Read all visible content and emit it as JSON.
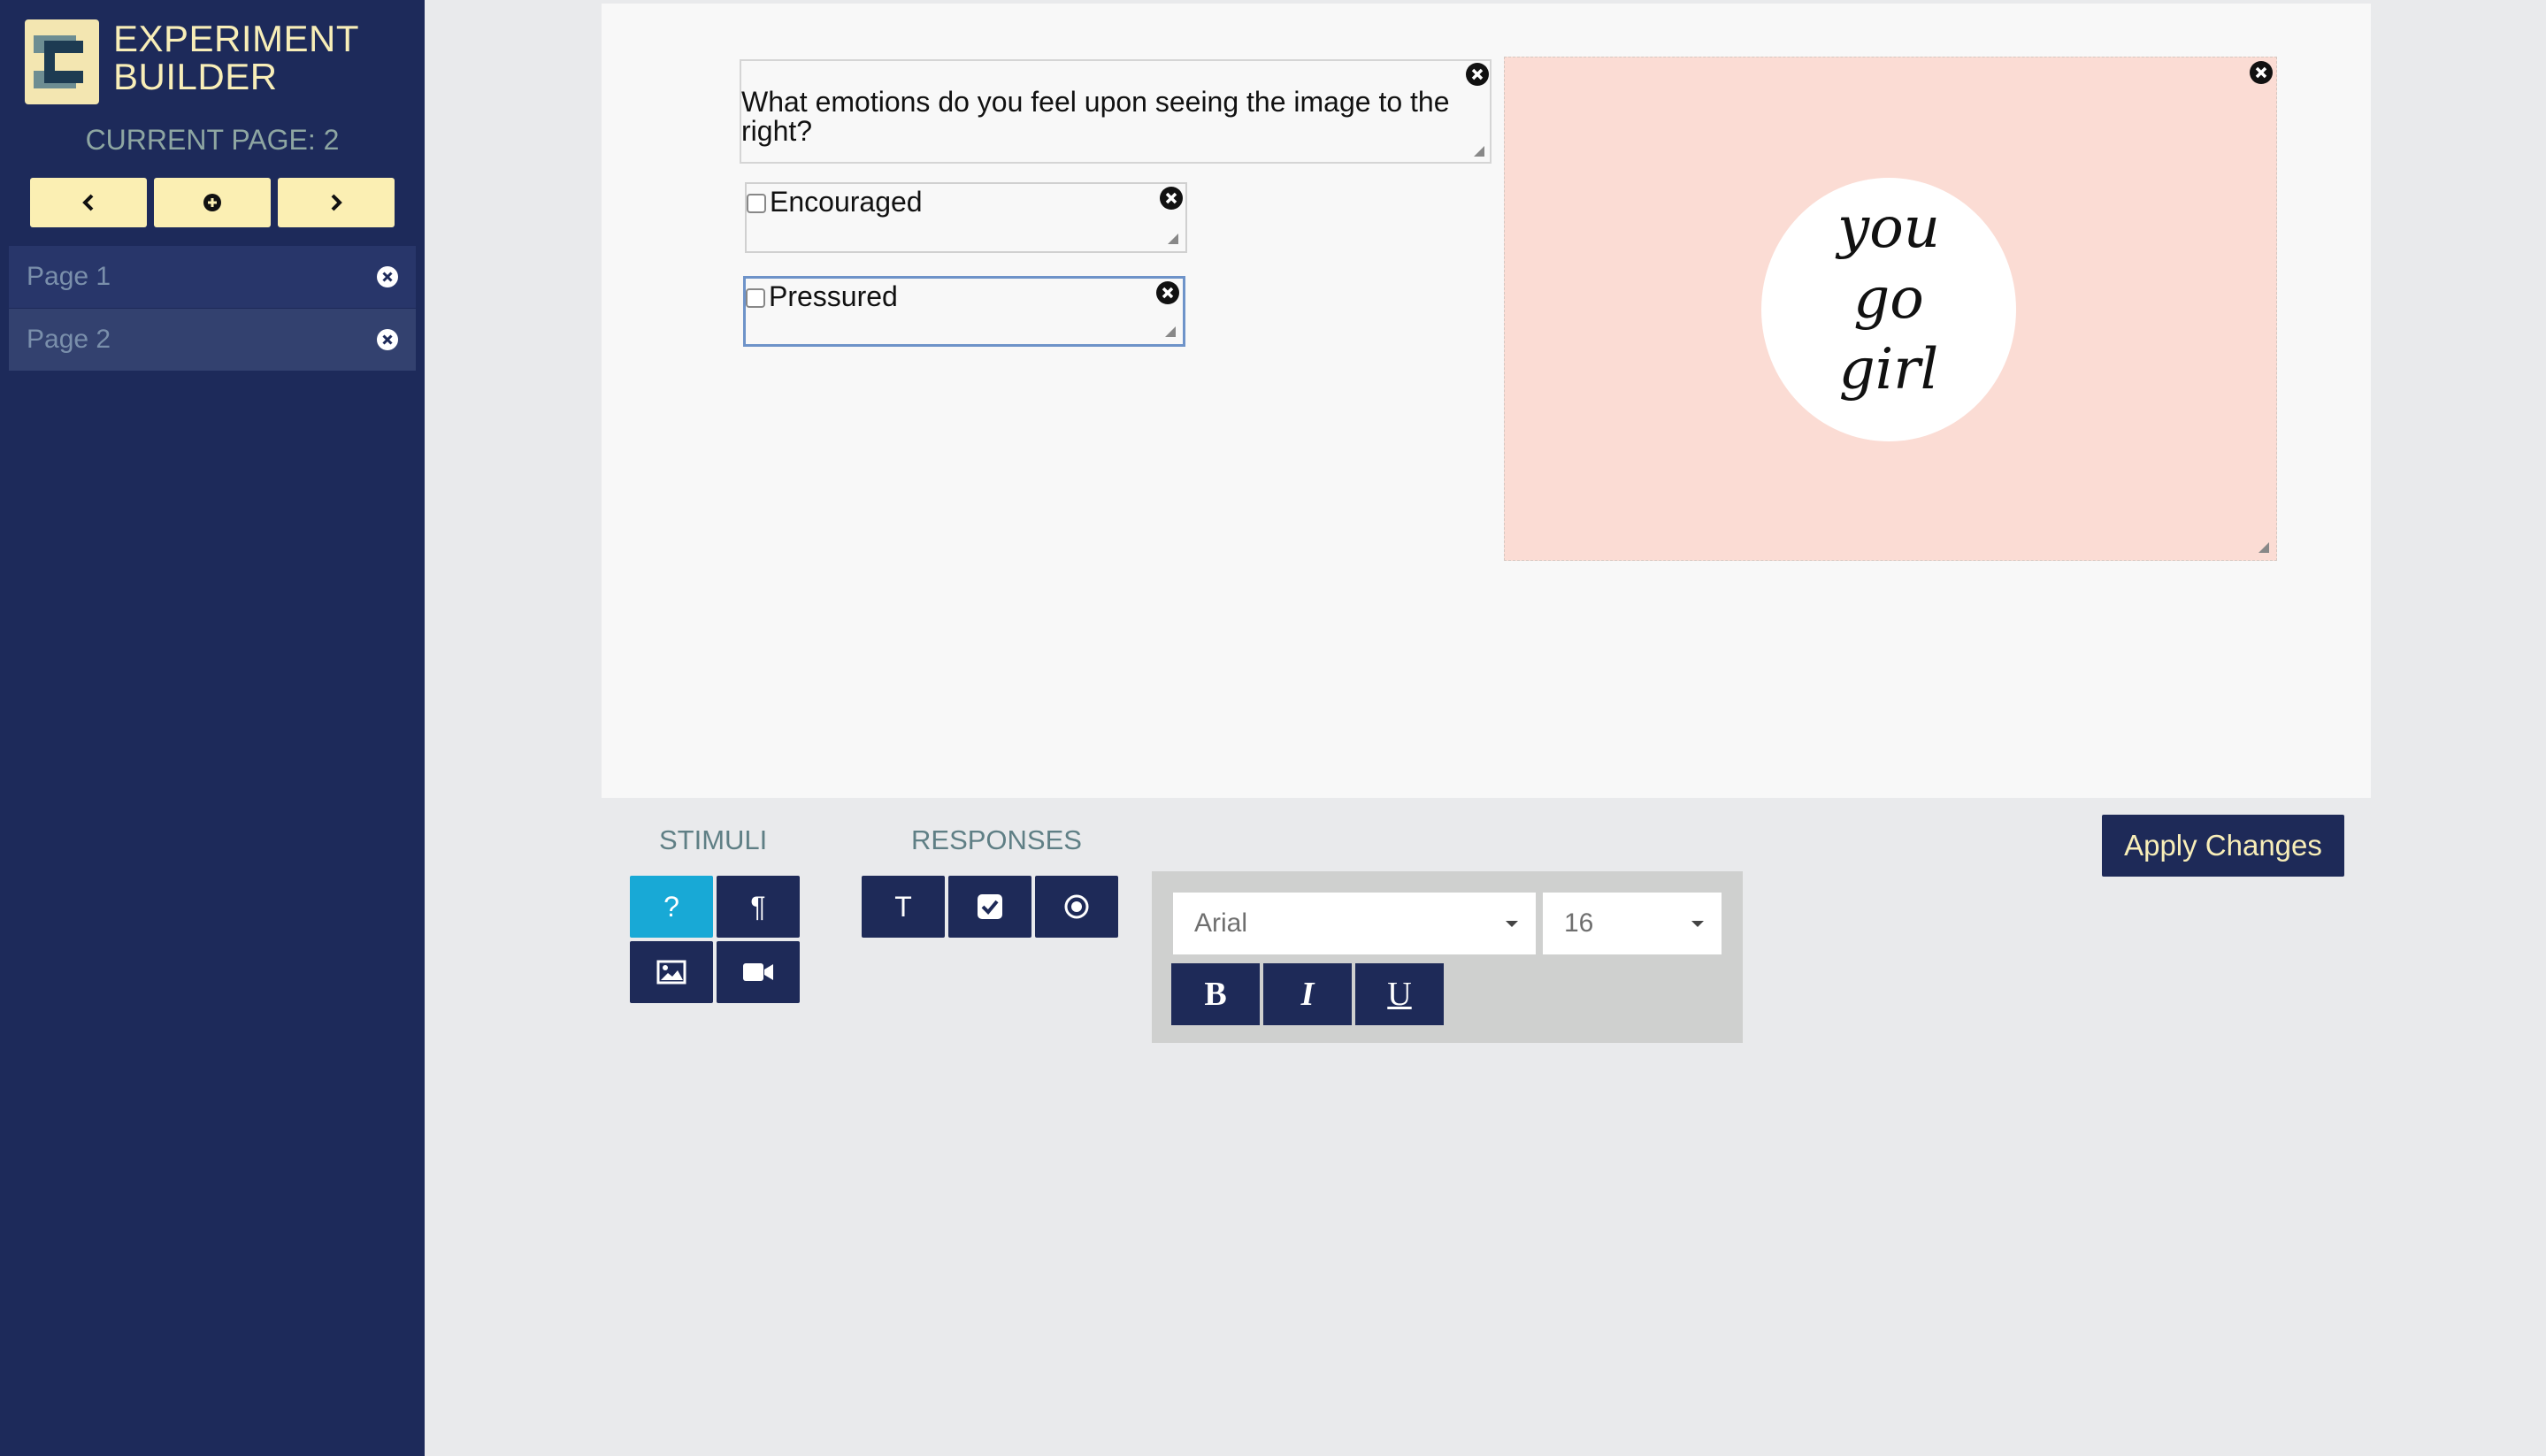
{
  "sidebar": {
    "brand_line1": "EXPERIMENT",
    "brand_line2": "BUILDER",
    "current_page_label": "CURRENT PAGE: 2",
    "nav": {
      "prev_icon": "chevron-left-icon",
      "add_icon": "plus-circle-icon",
      "next_icon": "chevron-right-icon"
    },
    "pages": [
      {
        "label": "Page 1",
        "active": false
      },
      {
        "label": "Page 2",
        "active": true
      }
    ]
  },
  "canvas": {
    "question_line1": "What emotions do you feel upon seeing the image to the",
    "question_line2": "right?",
    "responses": [
      {
        "label": "Encouraged",
        "checked": false,
        "focused": false
      },
      {
        "label": "Pressured",
        "checked": false,
        "focused": true
      }
    ],
    "image": {
      "background": "#fbdcd4",
      "text_line1": "you",
      "text_line2": "go",
      "text_line3": "girl"
    }
  },
  "toolbar": {
    "stimuli_title": "STIMULI",
    "responses_title": "RESPONSES",
    "stimuli_buttons": [
      {
        "icon": "question-icon",
        "glyph": "?",
        "active": true
      },
      {
        "icon": "paragraph-icon",
        "glyph": "¶",
        "active": false
      },
      {
        "icon": "image-icon",
        "active": false
      },
      {
        "icon": "video-camera-icon",
        "active": false
      }
    ],
    "response_buttons": [
      {
        "icon": "text-icon",
        "glyph": "T"
      },
      {
        "icon": "checkbox-icon"
      },
      {
        "icon": "radio-icon"
      }
    ],
    "font_family": "Arial",
    "font_size": "16",
    "bold_label": "B",
    "italic_label": "I",
    "underline_label": "U",
    "apply_label": "Apply Changes"
  },
  "colors": {
    "sidebar": "#1d2a5a",
    "accent_yellow": "#fbefb3",
    "button_navy": "#1e2a58",
    "active_cyan": "#18a9d6"
  }
}
